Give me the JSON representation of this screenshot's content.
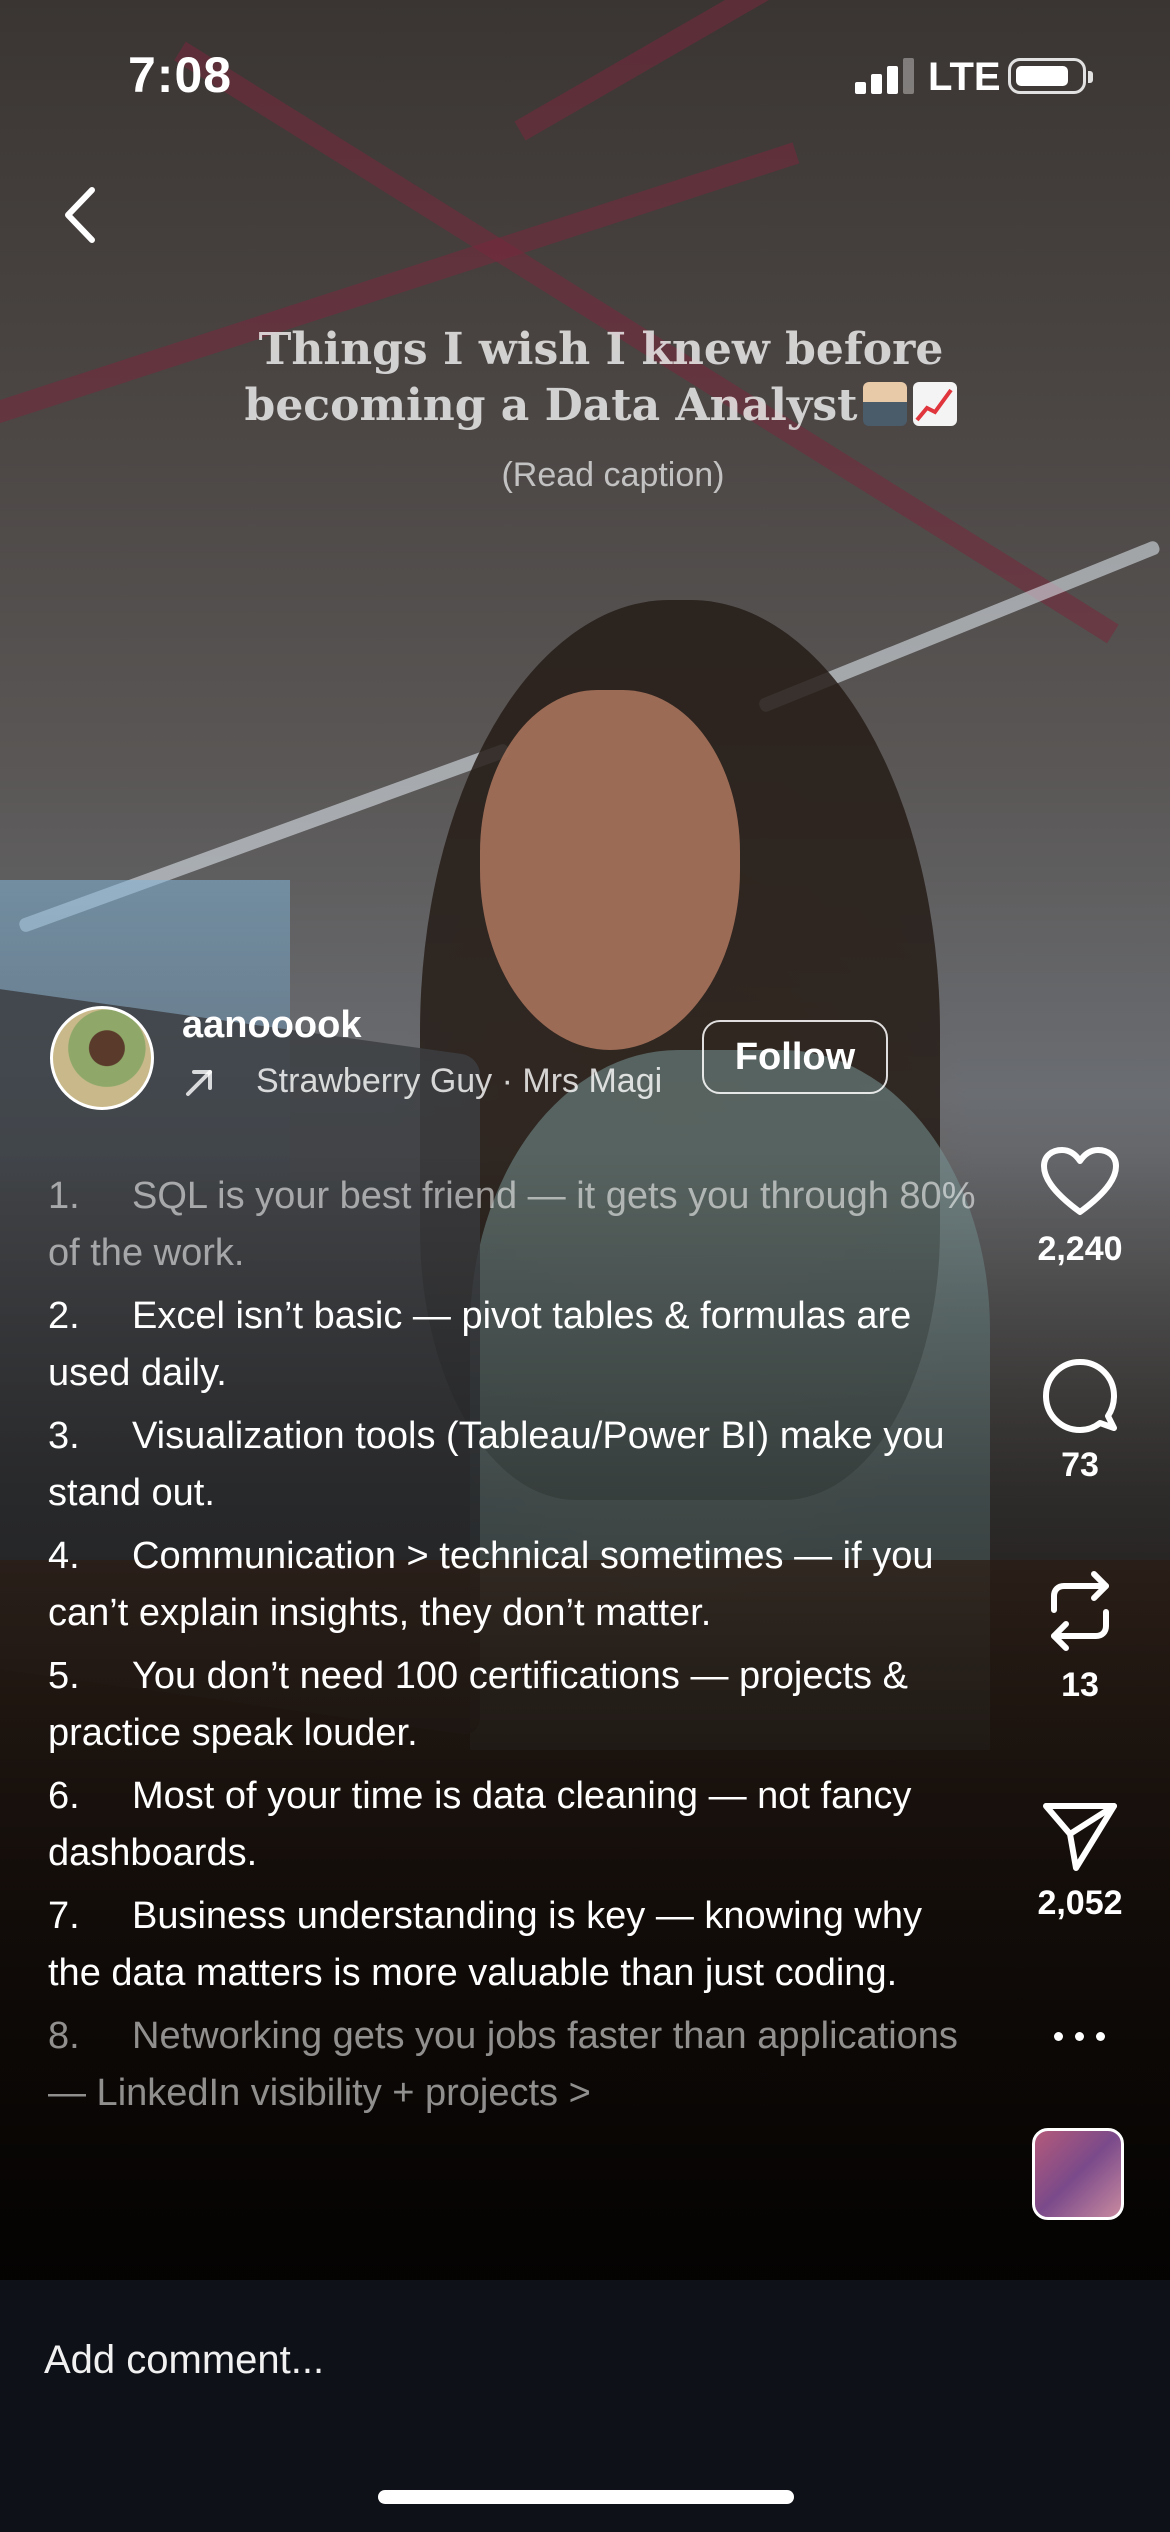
{
  "status_bar": {
    "time": "7:08",
    "network": "LTE",
    "signal_bars": 3,
    "battery_icon": "battery-icon"
  },
  "header": {
    "back_icon": "chevron-left-icon"
  },
  "video_overlay": {
    "title_line1": "Things I wish I knew before",
    "title_line2": "becoming a Data Analyst",
    "title_emojis": [
      "technologist-emoji",
      "chart-increasing-emoji"
    ],
    "subtitle": "(Read caption)"
  },
  "author": {
    "username": "aanooook",
    "audio_track": "Strawberry Guy · Mrs Magic",
    "follow_label": "Follow"
  },
  "caption": {
    "items": [
      {
        "n": "1.",
        "text": "SQL is your best friend — it gets you through 80% of the work."
      },
      {
        "n": "2.",
        "text": "Excel isn’t basic — pivot tables & formulas are used daily."
      },
      {
        "n": "3.",
        "text": "Visualization tools (Tableau/Power BI) make you stand out."
      },
      {
        "n": "4.",
        "text": "Communication > technical sometimes — if you can’t explain insights, they don’t matter."
      },
      {
        "n": "5.",
        "text": "You don’t need 100 certifications — projects & practice speak louder."
      },
      {
        "n": "6.",
        "text": "Most of your time is data cleaning — not fancy dashboards."
      },
      {
        "n": "7.",
        "text": "Business understanding is key — knowing why the data matters is more valuable than just coding."
      },
      {
        "n": "8.",
        "text": "Networking gets you jobs faster than applications — LinkedIn visibility + projects >"
      }
    ]
  },
  "actions": {
    "likes": "2,240",
    "comments": "73",
    "reposts": "13",
    "shares": "2,052"
  },
  "comment_bar": {
    "placeholder": "Add comment..."
  }
}
